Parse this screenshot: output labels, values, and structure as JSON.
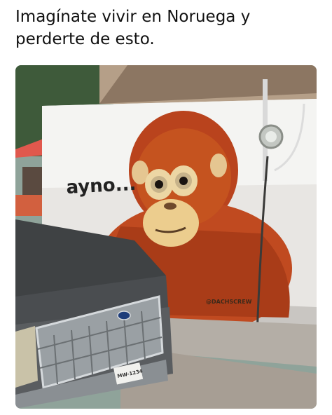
{
  "caption": "Imagínate vivir en Noruega y perderte de esto.",
  "wall": {
    "tag": "ayno...",
    "signature": "@DACHSCREW"
  },
  "plate": "MW-1234"
}
